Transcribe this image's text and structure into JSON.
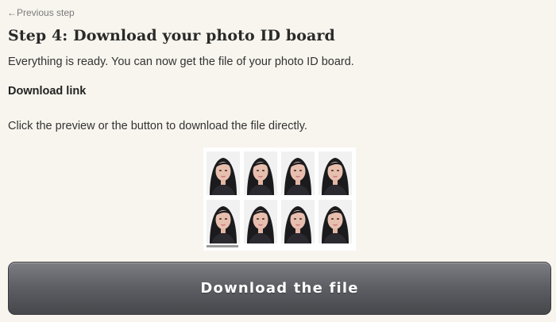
{
  "navigation": {
    "previous_step_label": "←Previous step"
  },
  "step": {
    "title": "Step 4: Download your photo ID board",
    "intro": "Everything is ready. You can now get the file of your photo ID board.",
    "download_heading": "Download link",
    "instruction": "Click the preview or the button to download the file directly."
  },
  "preview": {
    "photo_count": 8,
    "rows": 2,
    "columns": 4
  },
  "actions": {
    "download_label": "Download the file"
  },
  "colors": {
    "page_background": "#f8f5ee",
    "button_top": "#7d7e83",
    "button_bottom": "#46474b",
    "button_text": "#ffffff",
    "link_text": "#7a7a7a"
  }
}
